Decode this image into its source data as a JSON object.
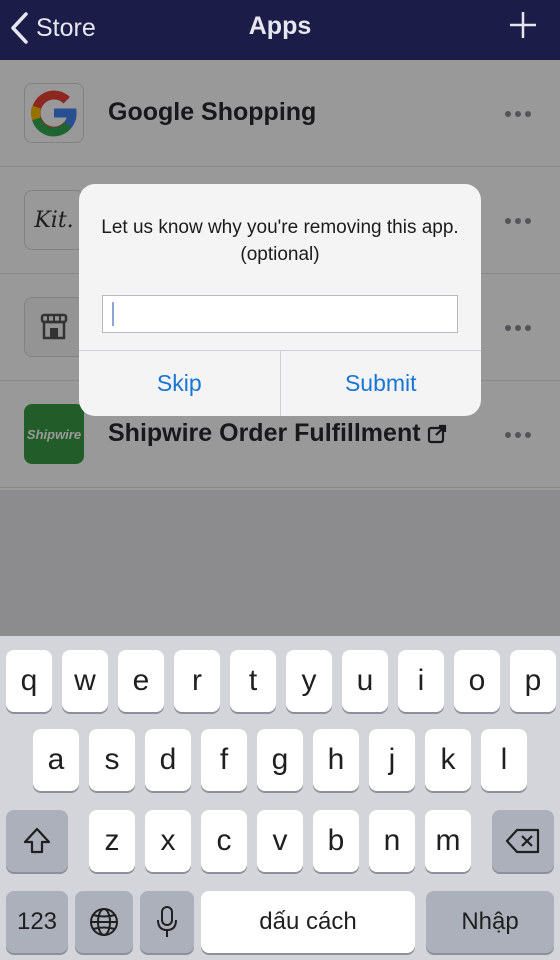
{
  "nav": {
    "back_label": "Store",
    "title": "Apps"
  },
  "apps": [
    {
      "name": "Google Shopping",
      "icon": "google-g-icon"
    },
    {
      "name": "",
      "icon": "kit-icon",
      "icon_text": "Kit."
    },
    {
      "name": "",
      "icon": "store-icon"
    },
    {
      "name": "Shipwire Order Fulfillment",
      "icon": "shipwire-icon",
      "icon_text": "Shipwire",
      "external_link": true
    }
  ],
  "alert": {
    "message": "Let us know why you're removing this app. (optional)",
    "input_value": "",
    "skip_label": "Skip",
    "submit_label": "Submit"
  },
  "keyboard": {
    "row1": [
      "q",
      "w",
      "e",
      "r",
      "t",
      "y",
      "u",
      "i",
      "o",
      "p"
    ],
    "row2": [
      "a",
      "s",
      "d",
      "f",
      "g",
      "h",
      "j",
      "k",
      "l"
    ],
    "row3": [
      "z",
      "x",
      "c",
      "v",
      "b",
      "n",
      "m"
    ],
    "numbers_label": "123",
    "space_label": "dấu cách",
    "return_label": "Nhập"
  },
  "colors": {
    "nav_bg": "#1b1c47",
    "accent": "#1875d6",
    "shipwire_green": "#3a9b45"
  }
}
